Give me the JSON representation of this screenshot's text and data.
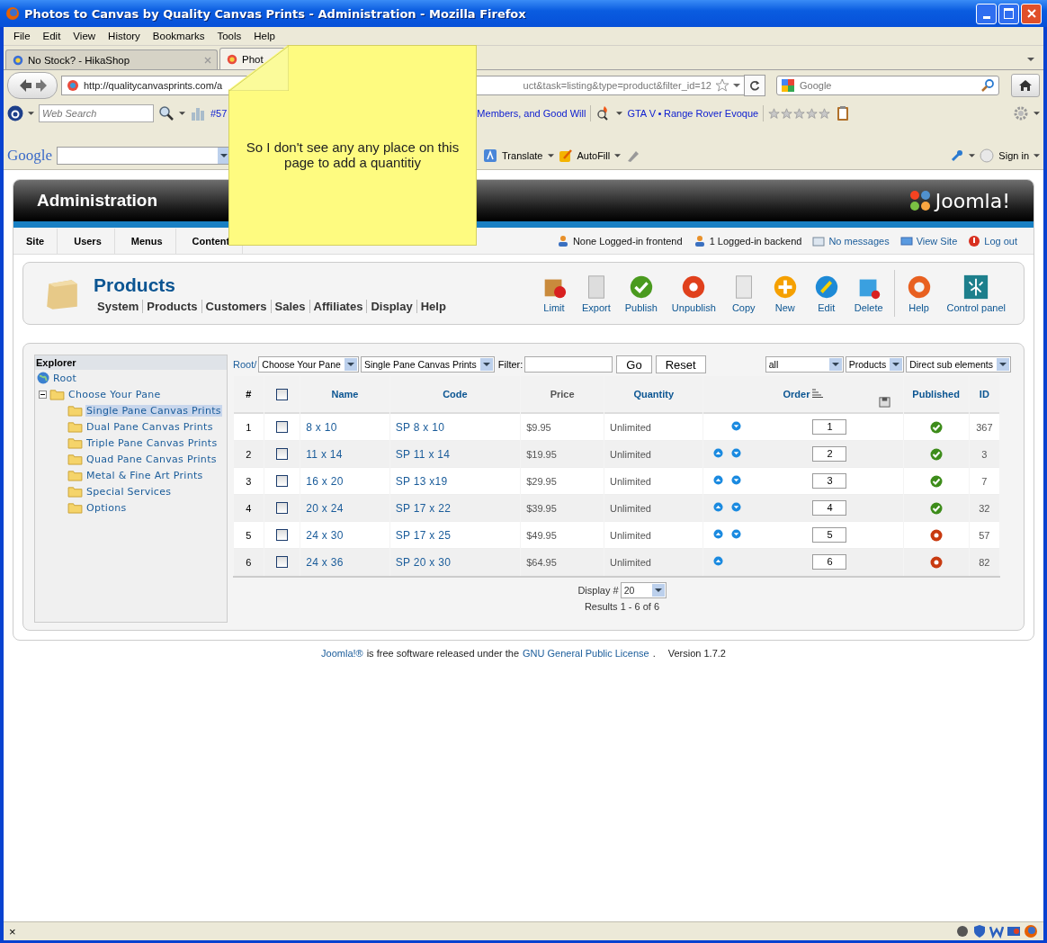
{
  "window": {
    "title": "Photos to Canvas by Quality Canvas Prints - Administration - Mozilla Firefox"
  },
  "menu": [
    "File",
    "Edit",
    "View",
    "History",
    "Bookmarks",
    "Tools",
    "Help"
  ],
  "tabs": [
    {
      "label": "No Stock? - HikaShop",
      "selected": false
    },
    {
      "label": "Phot",
      "selected": true
    }
  ],
  "nav": {
    "url_start": "http://qualitycanvasprints.com/a",
    "url_end": "uct&task=listing&type=product&filter_id=12",
    "search_placeholder": "Google"
  },
  "toolbar": {
    "search_placeholder": "Web Search",
    "links": [
      "#57",
      "Members, and Good Will",
      "GTA V",
      "Range Rover Evoque"
    ],
    "stars": 0
  },
  "google_bar": {
    "logo": "Google",
    "items": [
      "Translate",
      "AutoFill"
    ],
    "sign_in": "Sign in"
  },
  "sticky_note": {
    "text": "So I don't see any any place on this page to add a quantitiy"
  },
  "admin": {
    "title": "Administration",
    "brand": "Joomla!",
    "menu": [
      "Site",
      "Users",
      "Menus",
      "Content"
    ],
    "status": [
      {
        "text": "None Logged-in frontend",
        "link": false
      },
      {
        "text": "1 Logged-in backend",
        "link": false
      },
      {
        "text": "No messages",
        "link": true
      },
      {
        "text": "View Site",
        "link": true
      },
      {
        "text": "Log out",
        "link": true
      }
    ]
  },
  "component": {
    "title": "Products",
    "submenu": [
      "System",
      "Products",
      "Customers",
      "Sales",
      "Affiliates",
      "Display",
      "Help"
    ],
    "buttons": [
      "Limit",
      "Export",
      "Publish",
      "Unpublish",
      "Copy",
      "New",
      "Edit",
      "Delete",
      "Help",
      "Control panel"
    ]
  },
  "explorer": {
    "title": "Explorer",
    "root": "Root",
    "tree": [
      {
        "label": "Choose Your Pane",
        "expanded": true,
        "children": [
          {
            "label": "Single Pane Canvas Prints",
            "selected": true
          },
          {
            "label": "Dual Pane Canvas Prints",
            "selected": false
          },
          {
            "label": "Triple Pane Canvas Prints",
            "selected": false
          },
          {
            "label": "Quad Pane Canvas Prints",
            "selected": false
          },
          {
            "label": "Metal & Fine Art Prints",
            "selected": false
          },
          {
            "label": "Special Services",
            "selected": false
          },
          {
            "label": "Options",
            "selected": false
          }
        ]
      }
    ]
  },
  "filters": {
    "breadcrumb": "Root/",
    "selects": [
      "Choose Your Pane",
      "Single Pane Canvas Prints"
    ],
    "filter_label": "Filter:",
    "go": "Go",
    "reset": "Reset",
    "right_selects": [
      "all",
      "Products",
      "Direct sub elements"
    ]
  },
  "table": {
    "select_all": false,
    "columns": [
      "#",
      "Name",
      "Code",
      "Price",
      "Quantity",
      "Order",
      "Published",
      "ID"
    ],
    "rows": [
      {
        "num": "1",
        "checked": false,
        "name": "8 x 10",
        "code": "SP 8 x 10",
        "price": "$9.95",
        "quantity": "Unlimited",
        "up": false,
        "down": true,
        "order": "1",
        "published": true,
        "id": "367"
      },
      {
        "num": "2",
        "checked": false,
        "name": "11 x 14",
        "code": "SP 11 x 14",
        "price": "$19.95",
        "quantity": "Unlimited",
        "up": true,
        "down": true,
        "order": "2",
        "published": true,
        "id": "3"
      },
      {
        "num": "3",
        "checked": false,
        "name": "16 x 20",
        "code": "SP 13 x19",
        "price": "$29.95",
        "quantity": "Unlimited",
        "up": true,
        "down": true,
        "order": "3",
        "published": true,
        "id": "7"
      },
      {
        "num": "4",
        "checked": false,
        "name": "20 x 24",
        "code": "SP 17 x 22",
        "price": "$39.95",
        "quantity": "Unlimited",
        "up": true,
        "down": true,
        "order": "4",
        "published": true,
        "id": "32"
      },
      {
        "num": "5",
        "checked": false,
        "name": "24 x 30",
        "code": "SP 17 x 25",
        "price": "$49.95",
        "quantity": "Unlimited",
        "up": true,
        "down": true,
        "order": "5",
        "published": false,
        "id": "57"
      },
      {
        "num": "6",
        "checked": false,
        "name": "24 x 36",
        "code": "SP 20 x 30",
        "price": "$64.95",
        "quantity": "Unlimited",
        "up": true,
        "down": false,
        "order": "6",
        "published": false,
        "id": "82"
      }
    ]
  },
  "pagination": {
    "label": "Display #",
    "value": "20",
    "results": "Results 1 - 6 of 6"
  },
  "footer": [
    {
      "text": "Joomla!®",
      "link": true
    },
    {
      "text": "is free software released under the",
      "link": false
    },
    {
      "text": "GNU General Public License",
      "link": true
    },
    {
      "text": ".",
      "link": false
    },
    {
      "text": "Version 1.7.2",
      "link": false
    }
  ],
  "status_bar": {
    "close": "×"
  }
}
